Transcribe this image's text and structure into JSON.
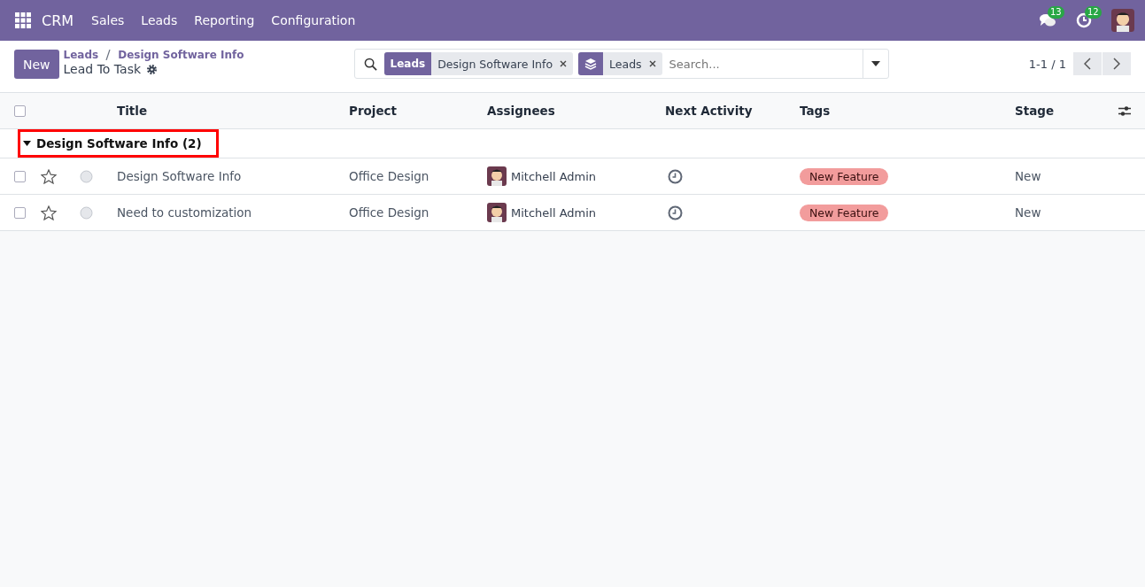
{
  "navbar": {
    "app": "CRM",
    "menu": [
      "Sales",
      "Leads",
      "Reporting",
      "Configuration"
    ],
    "messages_count": "13",
    "activities_count": "12"
  },
  "control_panel": {
    "new_button": "New",
    "breadcrumb": [
      "Leads",
      "Design Software Info"
    ],
    "title": "Lead To Task",
    "pager": "1-1 / 1"
  },
  "search": {
    "facets": [
      {
        "kind": "filter",
        "label": "Leads",
        "value": "Design Software Info"
      },
      {
        "kind": "group",
        "value": "Leads"
      }
    ],
    "placeholder": "Search..."
  },
  "table": {
    "select_all_checked": false,
    "columns": [
      "Title",
      "Project",
      "Assignees",
      "Next Activity",
      "Tags",
      "Stage"
    ],
    "groups": [
      {
        "label": "Design Software Info (2)",
        "expanded": true,
        "highlighted": true,
        "rows": [
          {
            "checked": false,
            "favorite": false,
            "title": "Design Software Info",
            "project": "Office Design",
            "assignee": "Mitchell Admin",
            "tag": "New Feature",
            "color": "#f29c9c",
            "stage": "New"
          },
          {
            "checked": false,
            "favorite": false,
            "title": "Need to customization",
            "project": "Office Design",
            "assignee": "Mitchell Admin",
            "tag": "New Feature",
            "color": "#f29c9c",
            "stage": "New"
          }
        ]
      }
    ]
  }
}
